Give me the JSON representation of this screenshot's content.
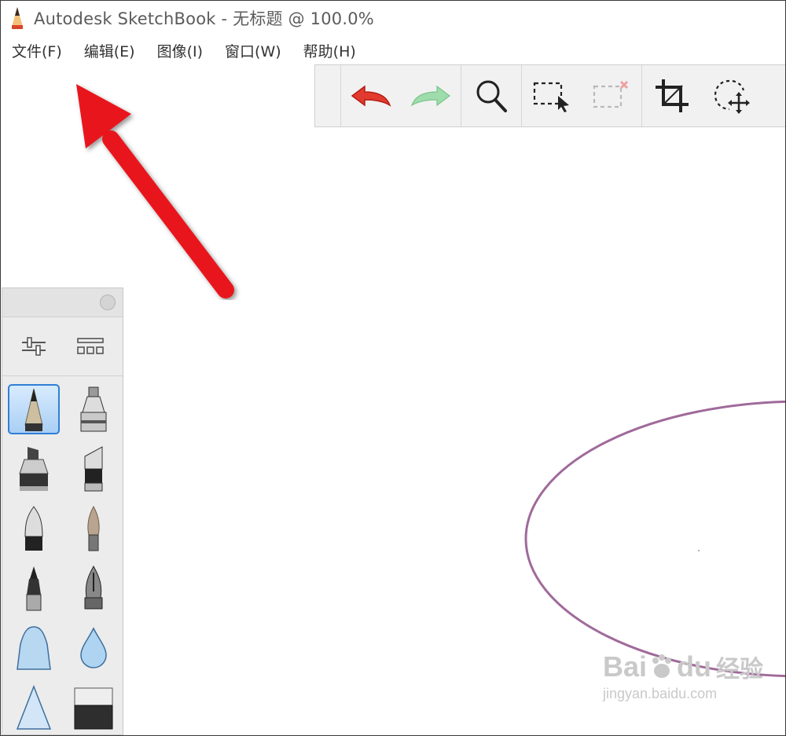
{
  "window": {
    "title": "Autodesk SketchBook - 无标题 @ 100.0%",
    "app_icon": "pencil-icon"
  },
  "menubar": {
    "items": [
      "文件(F)",
      "编辑(E)",
      "图像(I)",
      "窗口(W)",
      "帮助(H)"
    ]
  },
  "toolbar": {
    "buttons": [
      "undo-icon",
      "redo-icon",
      "zoom-icon",
      "select-icon",
      "deselect-icon",
      "crop-icon",
      "transform-icon"
    ]
  },
  "palette": {
    "tools": [
      "brush-properties-icon",
      "brush-library-icon"
    ],
    "brushes": [
      "pencil",
      "airbrush",
      "marker",
      "chisel-marker",
      "ballpoint-pen",
      "paint-brush",
      "felt-pen",
      "ink-pen",
      "soft-brush",
      "water-drop",
      "hard-brush",
      "eraser"
    ],
    "selected": "pencil"
  },
  "watermark": {
    "brand": "Bai",
    "brand2": "du",
    "cn": "经验",
    "url": "jingyan.baidu.com"
  },
  "colors": {
    "stroke": "#a06a9a",
    "accent": "#2f7fd6",
    "arrow": "#e8121a"
  }
}
